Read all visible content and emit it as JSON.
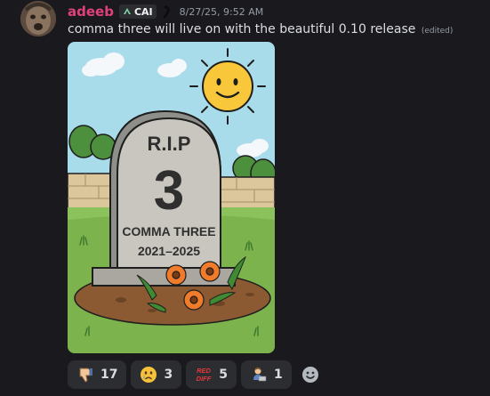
{
  "message": {
    "author": "adeeb",
    "author_color": "#e0407b",
    "tag": "CAI",
    "timestamp": "8/27/25, 9:52 AM",
    "text": "comma three will live on with the beautiful 0.10 release",
    "edited_label": "(edited)"
  },
  "attachment": {
    "headstone_title": "R.I.P",
    "headstone_number": "3",
    "headstone_name": "COMMA THREE",
    "headstone_years": "2021–2025"
  },
  "reactions": [
    {
      "emoji": "thumbs-down-icon",
      "count": "17"
    },
    {
      "emoji": "crying-face-icon",
      "count": "3"
    },
    {
      "emoji": "red-diff-icon",
      "count": "5"
    },
    {
      "emoji": "person-at-laptop-icon",
      "count": "1"
    }
  ],
  "icons": {
    "tag": "cai-leaf-icon",
    "flair": "flair-icon",
    "add_reaction": "smiley-icon"
  },
  "colors": {
    "background": "#1a1a1e",
    "reaction_bg": "#2b2d31",
    "timestamp": "#949ba4"
  }
}
